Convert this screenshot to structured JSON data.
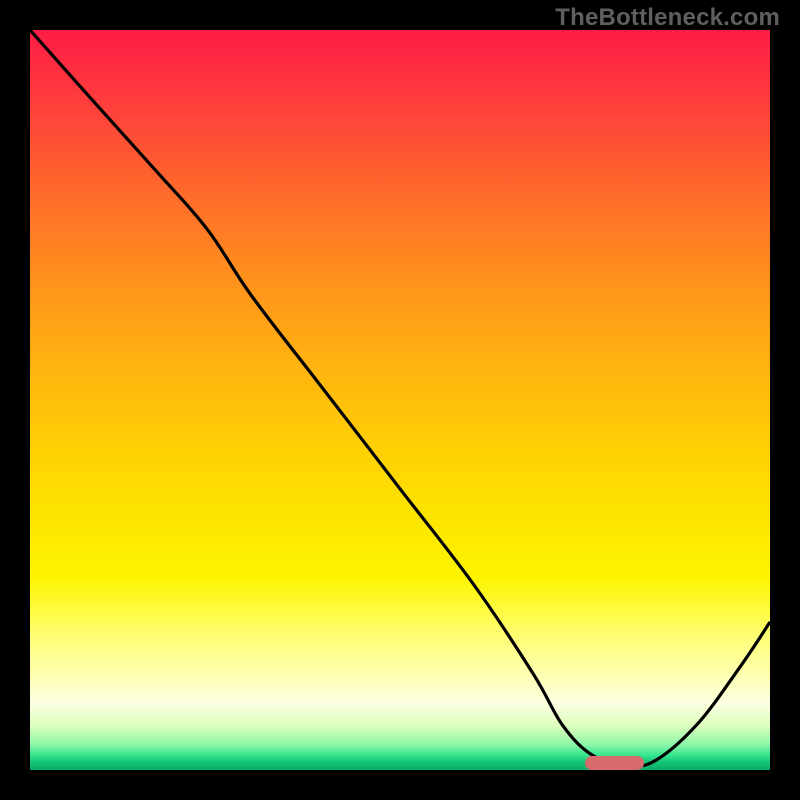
{
  "watermark": "TheBottleneck.com",
  "colors": {
    "frame": "#000000",
    "watermark_text": "#5f5f5f",
    "curve": "#000000",
    "marker": "#d86b6d",
    "gradient_top": "#fd1c44",
    "gradient_bottom": "#0aab6a"
  },
  "chart_data": {
    "type": "line",
    "title": "",
    "xlabel": "",
    "ylabel": "",
    "xlim": [
      0,
      100
    ],
    "ylim": [
      0,
      100
    ],
    "grid": false,
    "legend": null,
    "series": [
      {
        "name": "bottleneck-curve",
        "x": [
          0,
          8,
          17,
          24,
          30,
          40,
          50,
          60,
          68,
          72,
          76,
          80,
          84,
          90,
          96,
          100
        ],
        "y": [
          100,
          91,
          81,
          73,
          64,
          51,
          38,
          25,
          13,
          6,
          2,
          1,
          1,
          6,
          14,
          20
        ]
      }
    ],
    "marker": {
      "x_range": [
        75,
        83
      ],
      "y": 1,
      "label": ""
    },
    "background": "vertical-gradient red→yellow→green (bottleneck heatmap)"
  }
}
